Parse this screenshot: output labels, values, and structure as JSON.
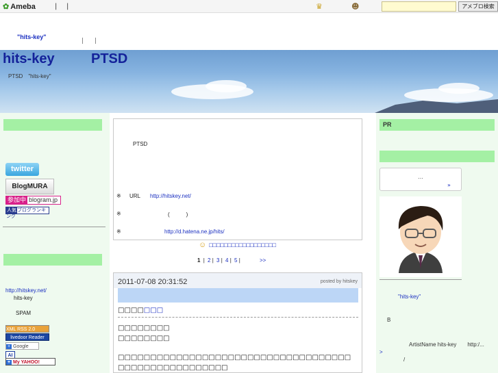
{
  "topbar": {
    "logo_text": "Ameba",
    "sep1": "|",
    "sep2": "|",
    "search_placeholder": "",
    "search_button": "アメブロ検索",
    "icons": [
      "crown-icon",
      "face-icon"
    ]
  },
  "subheader": {
    "link": "\"hits-key\"",
    "sep1": "|",
    "sep2": "|"
  },
  "banner": {
    "title_left": "hits-key",
    "title_right": "PTSD",
    "description": "PTSD　\"hits-key\""
  },
  "left": {
    "twitter_label": "twitter",
    "blogmura_label": "BlogMURA",
    "blogram_tag": "参加中",
    "blogram_name": "blogram.jp",
    "rank_tag": "人気",
    "rank_name": "ブログランキング",
    "url": "http://hitskey.net/",
    "name": "hits-key",
    "spam": "SPAM",
    "feeds": {
      "xml": "XML  RSS 2.0",
      "ldr": "livedoor Reader",
      "google": "Google",
      "ai": "AI",
      "yahoo": "My YAHOO!"
    }
  },
  "profile": {
    "line1": "PTSD",
    "line2_mark": "※",
    "line2_label": "URL",
    "line2_link": "http://hitskey.net/",
    "line3_mark": "※",
    "line3_text": "(　　　)",
    "line4_mark": "※",
    "line4_link": "http://d.hatena.ne.jp/hits/"
  },
  "recommend": {
    "text": "□□□□□□□□□□□□□□□□□□"
  },
  "pager": {
    "current": "1",
    "pages": [
      "2",
      "3",
      "4",
      "5"
    ],
    "next": ">>"
  },
  "entry": {
    "date": "2011-07-08 20:31:52",
    "posted_by": "posted by hitskey",
    "theme_prefix": "□□□□",
    "theme_link": "□□□",
    "text1": "□□□□□□□□",
    "text2": "□□□□□□□□",
    "text3": "□□□□□□□□□□□□□□□□□□□□□□□□□□□□□□□□□□□□",
    "text4": "□□□□□□□□□□□□□□□□□"
  },
  "right": {
    "pr_label": "PR",
    "bubble_dots": "…",
    "bubble_mark": "»",
    "name": "\"hits-key\"",
    "b_label": "B",
    "artist_text": "ArtistName hits-key　　http:/...",
    "artist_gt": ">",
    "slash": "/"
  }
}
